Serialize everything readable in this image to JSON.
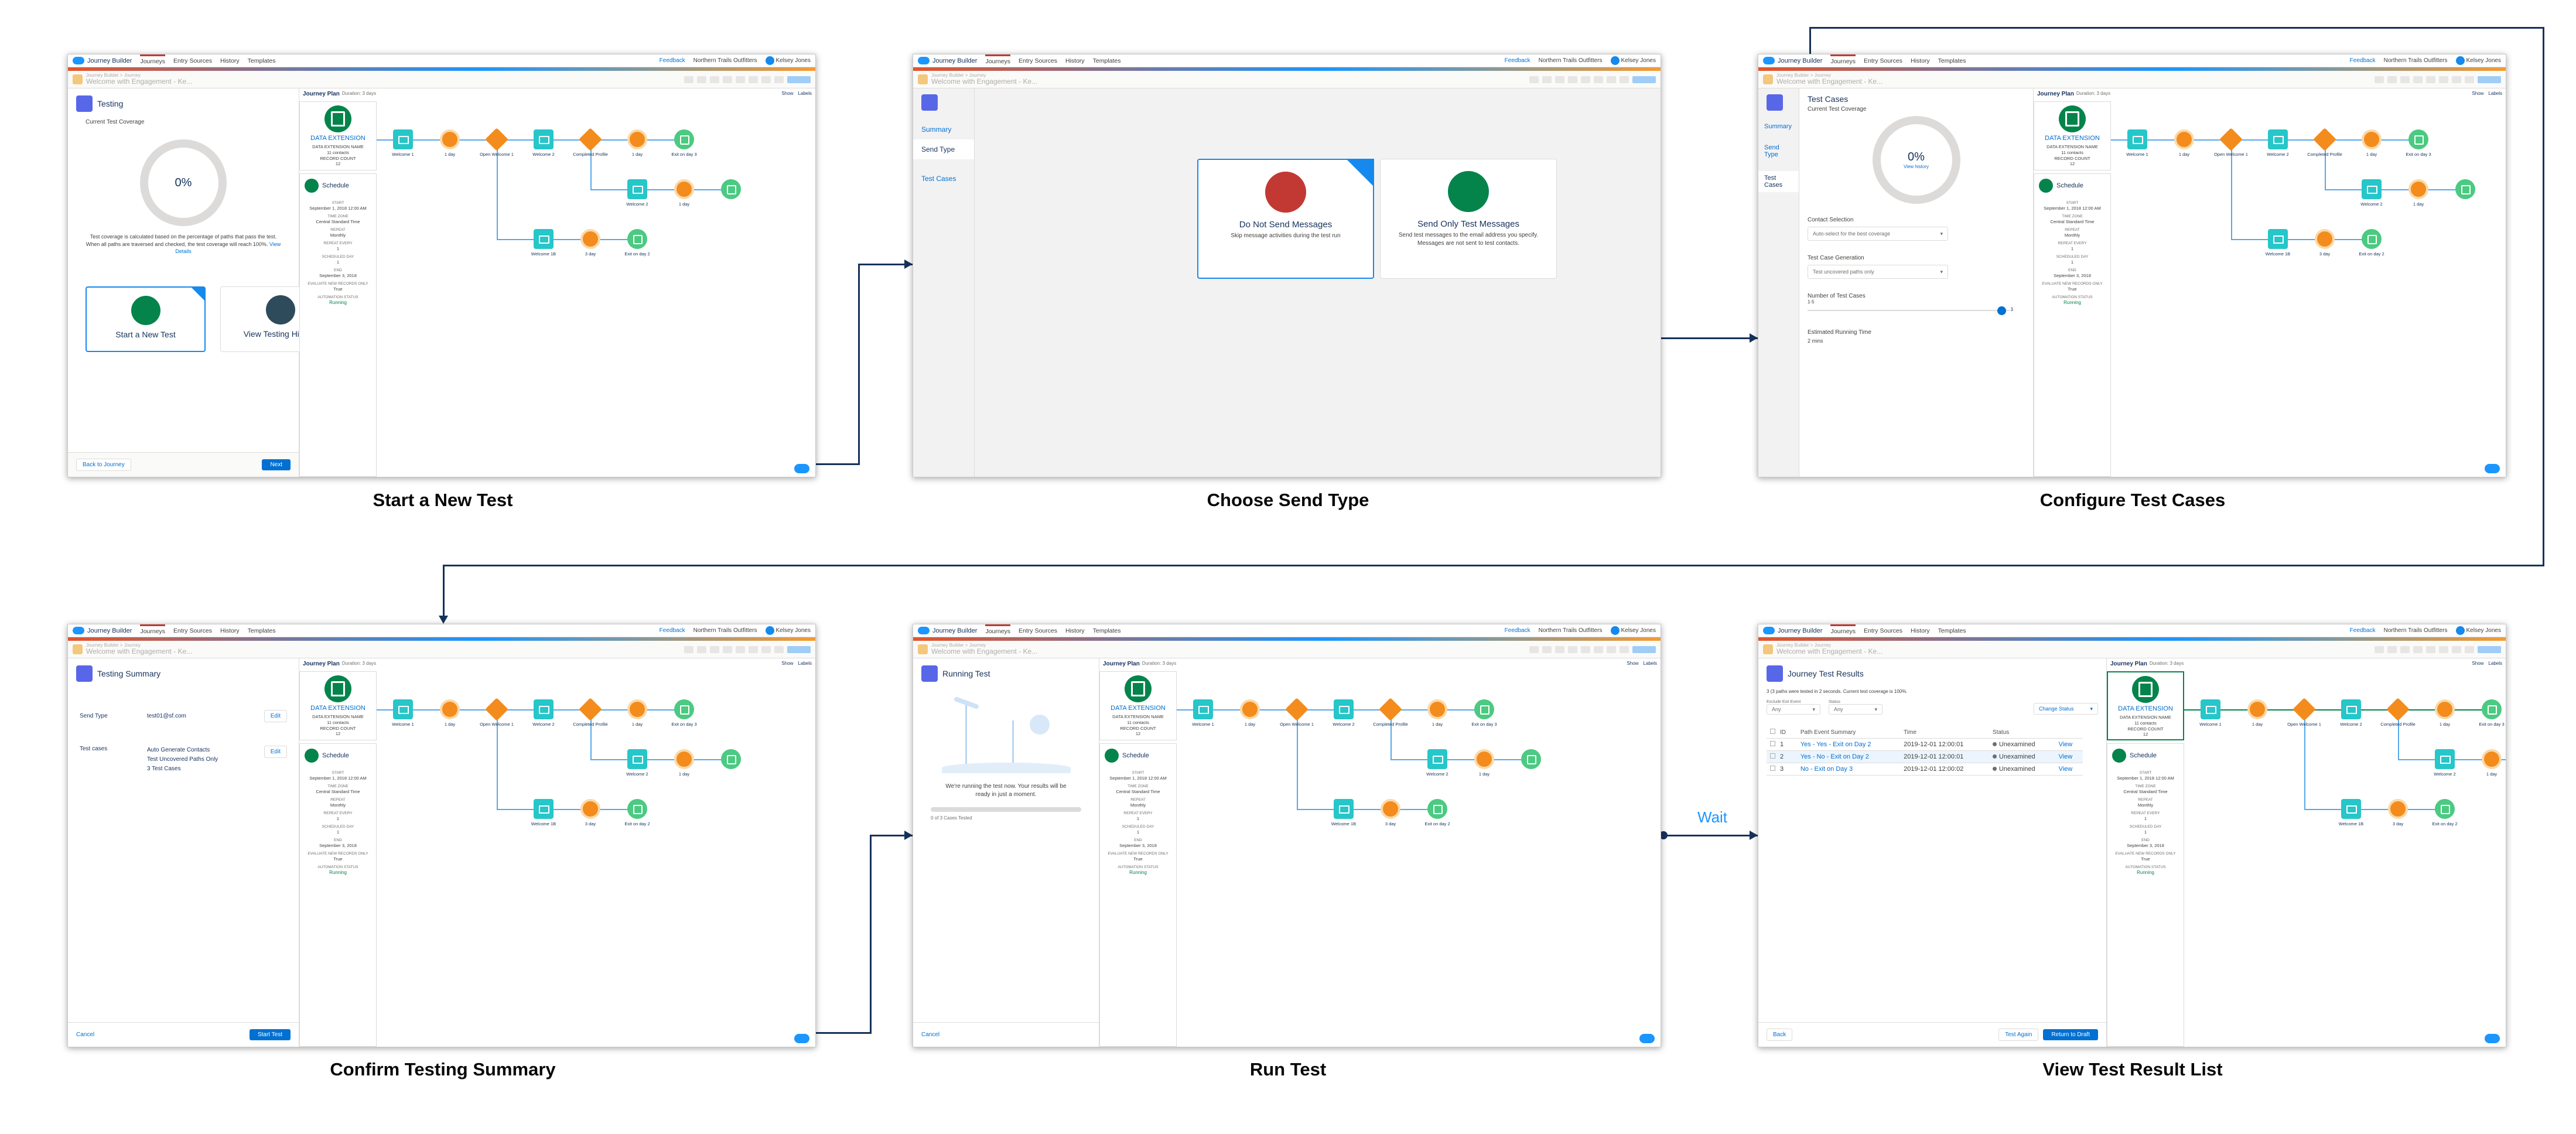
{
  "global": {
    "app_name": "Journey Builder",
    "tabs": [
      "Journeys",
      "Entry Sources",
      "History",
      "Templates"
    ],
    "feedback": "Feedback",
    "org": "Northern Trails Outfitters",
    "user": "Kelsey Jones"
  },
  "journey": {
    "breadcrumb": "Journey Builder > Journey",
    "name": "Welcome with Engagement - Ke...",
    "plan_title": "Journey Plan",
    "duration": "Duration: 3 days",
    "show": "Show",
    "labels": "Labels",
    "entry": {
      "title": "DATA EXTENSION",
      "lines": [
        "DATA EXTENSION NAME",
        "11 contacts",
        "RECORD COUNT",
        "12"
      ]
    },
    "schedule": {
      "title": "Schedule",
      "fields": [
        {
          "label": "START",
          "value": "September 1, 2018 12:00 AM"
        },
        {
          "label": "TIME ZONE",
          "value": "Central Standard Time"
        },
        {
          "label": "REPEAT",
          "value": "Monthly"
        },
        {
          "label": "REPEAT EVERY",
          "value": "1"
        },
        {
          "label": "SCHEDULED DAY",
          "value": "1"
        },
        {
          "label": "END",
          "value": "September 3, 2018"
        },
        {
          "label": "EVALUATE NEW RECORDS ONLY",
          "value": "True"
        },
        {
          "label": "AUTOMATION STATUS",
          "value": "Running"
        }
      ]
    },
    "node_labels": {
      "welcome1": "Welcome 1",
      "day1": "1 day",
      "open_welcome": "Open Welcome 1",
      "welcome2": "Welcome 2",
      "completed": "Completed Profile",
      "day1b": "1 day",
      "exit1": "Exit on day 3",
      "welcome2b": "Welcome 2",
      "day1c": "1 day",
      "welcome1b": "Welcome 1B",
      "day3": "3 day",
      "exit2": "Exit on day 2"
    }
  },
  "steps": [
    {
      "caption": "Start a New Test"
    },
    {
      "caption": "Choose Send Type"
    },
    {
      "caption": "Configure Test Cases"
    },
    {
      "caption": "Confirm Testing Summary"
    },
    {
      "caption": "Run Test"
    },
    {
      "caption": "View Test Result List"
    }
  ],
  "wait_label": "Wait",
  "s1": {
    "title": "Testing",
    "coverage_label": "Current Test Coverage",
    "coverage": "0%",
    "coverage_pct": 0,
    "note": "Test coverage is calculated based on the percentage of paths that pass the test. When all paths are traversed and checked, the test coverage will reach 100%.",
    "note_link": "View Details",
    "start_test": "Start a New Test",
    "view_history": "View Testing History",
    "back": "Back to Journey",
    "next": "Next"
  },
  "s2": {
    "tabs": [
      "Summary",
      "Send Type",
      "Test Cases"
    ],
    "card1_title": "Do Not Send Messages",
    "card1_desc": "Skip message activities during the test run",
    "card2_title": "Send Only Test Messages",
    "card2_desc": "Send test messages to the email address you specify. Messages are not sent to test contacts."
  },
  "s3": {
    "tabs": [
      "Summary",
      "Send Type",
      "Test Cases"
    ],
    "title": "Test Cases",
    "coverage_label": "Current Test Coverage",
    "coverage": "0%",
    "view_history": "View history",
    "contact_label": "Contact Selection",
    "contact_value": "Auto-select for the best coverage",
    "gen_label": "Test Case Generation",
    "gen_value": "Test uncovered paths only",
    "num_label": "Number of Test Cases",
    "num_min": "1-5",
    "num_max": "3",
    "time_label": "Estimated Running Time",
    "time_value": "2 mins"
  },
  "s4": {
    "title": "Testing Summary",
    "send_type_label": "Send Type",
    "send_type_value": "test01@sf.com",
    "edit": "Edit",
    "cases_label": "Test cases",
    "cases_values": [
      "Auto Generate Contacts",
      "Test Uncovered Paths Only",
      "3 Test Cases"
    ],
    "cancel": "Cancel",
    "start": "Start Test"
  },
  "s5": {
    "title": "Running Test",
    "message": "We're running the test now. Your results will be ready in just a moment.",
    "progress": "0 of 3 Cases Tested",
    "cancel": "Cancel"
  },
  "s6": {
    "title": "Journey Test Results",
    "summary": "3 (3 paths were tested in 2 seconds. Current test coverage is 100%.",
    "filter1": "Exclude Exit Event",
    "filter1_val": "Any",
    "filter2": "Status",
    "filter2_val": "Any",
    "change_status": "Change Status",
    "columns": [
      "ID",
      "Path Event Summary",
      "Time",
      "Status",
      ""
    ],
    "rows": [
      {
        "id": "1",
        "path": "Yes - Yes - Exit on Day 2",
        "time": "2019-12-01 12:00:01",
        "status": "Unexamined",
        "view": "View"
      },
      {
        "id": "2",
        "path": "Yes - No - Exit on Day 2",
        "time": "2019-12-01 12:00:01",
        "status": "Unexamined",
        "view": "View"
      },
      {
        "id": "3",
        "path": "No - Exit on Day 3",
        "time": "2019-12-01 12:00:02",
        "status": "Unexamined",
        "view": "View"
      }
    ],
    "back": "Back",
    "test_again": "Test Again",
    "return": "Return to Draft"
  },
  "colors": {
    "accent": "#0070d2",
    "success": "#04844b",
    "email": "#26c6c9",
    "wait": "#f38c1c",
    "flow": "#16325c"
  }
}
